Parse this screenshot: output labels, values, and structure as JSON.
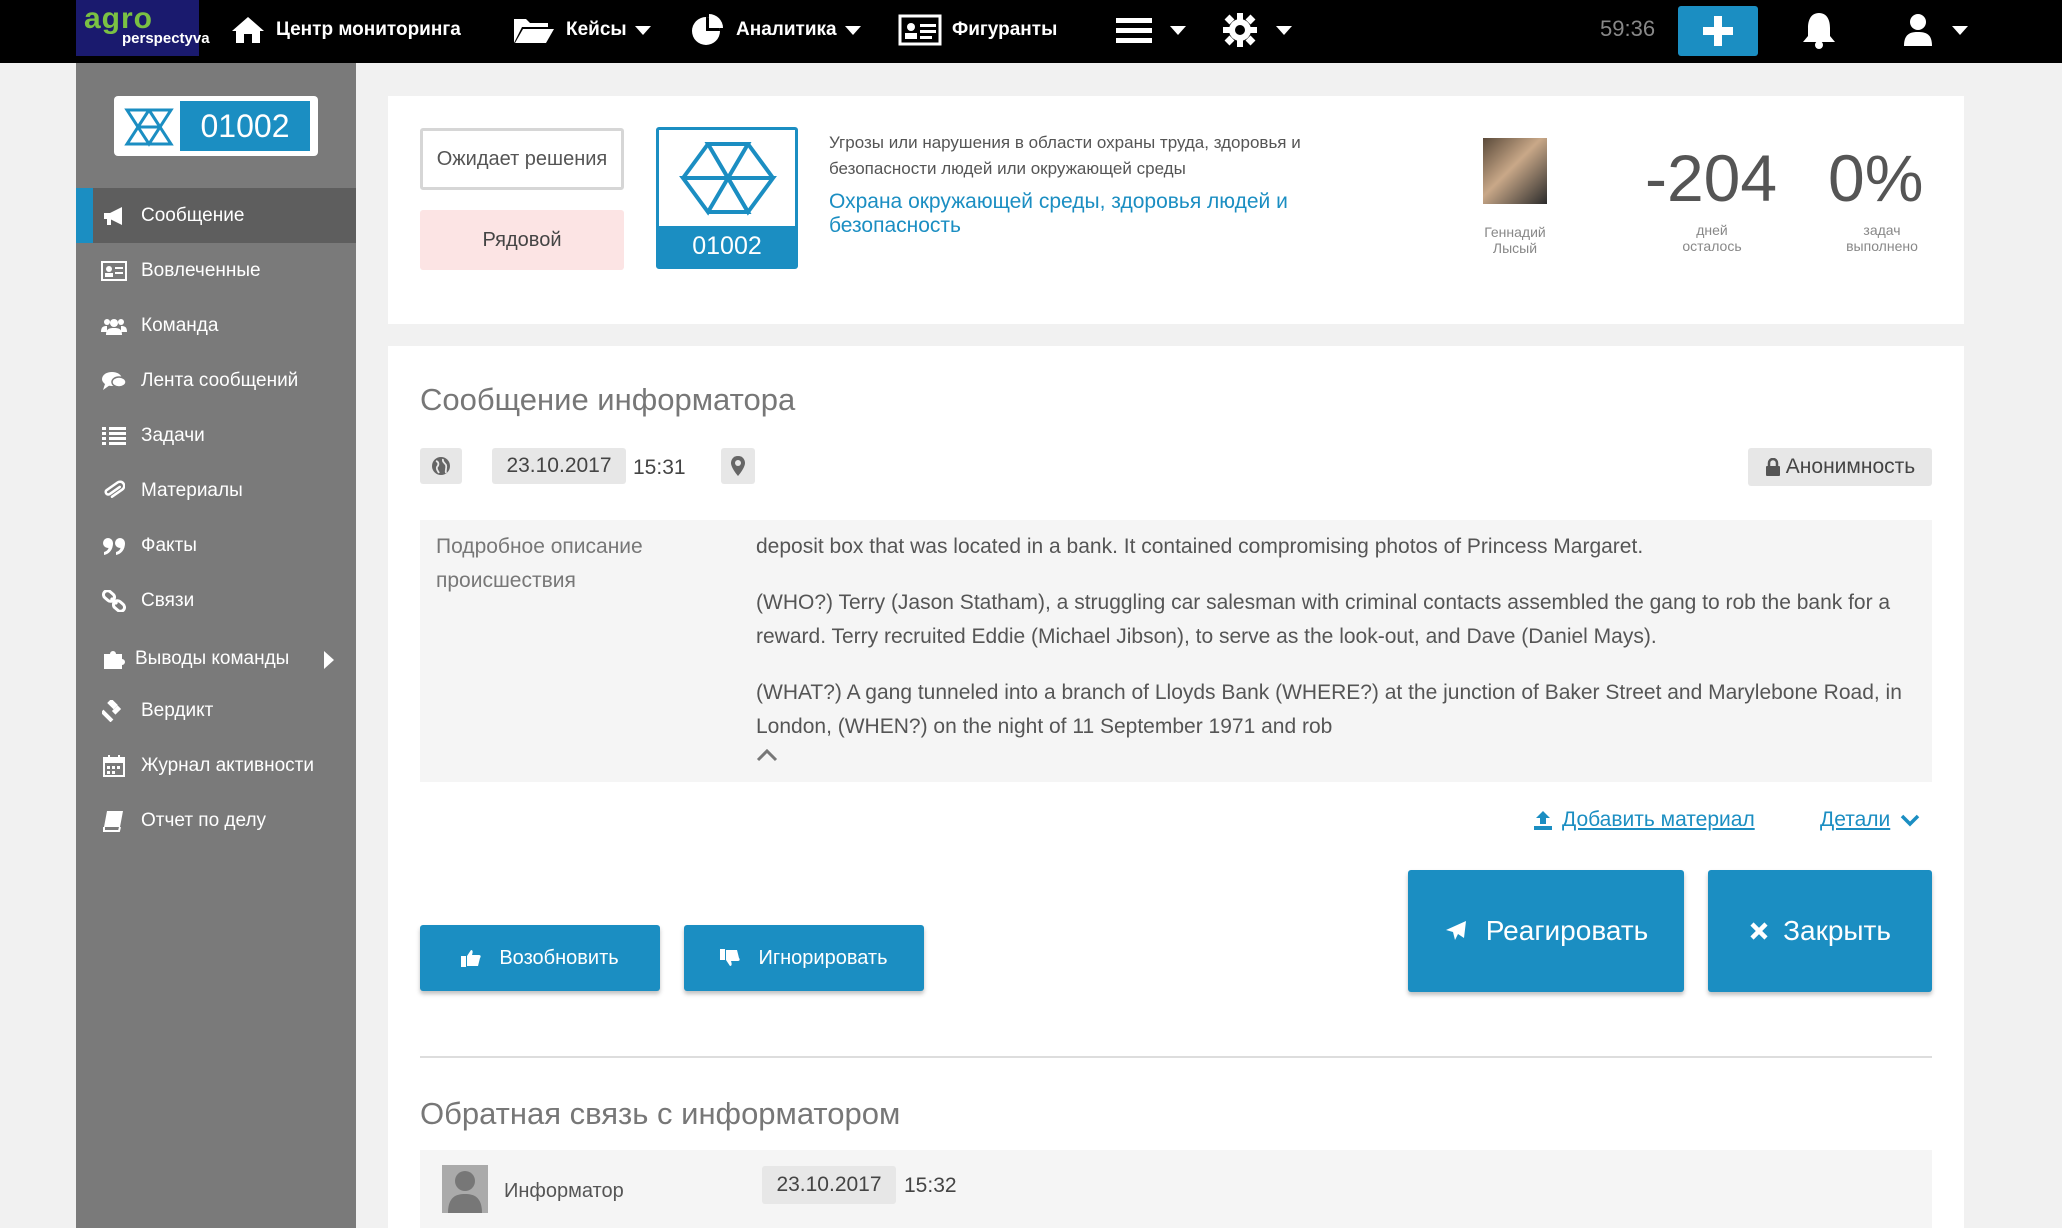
{
  "topbar": {
    "logo_top": "agro",
    "logo_bottom": "perspectyva",
    "nav": [
      {
        "label": "Центр мониторинга",
        "icon": "home-icon"
      },
      {
        "label": "Кейсы",
        "icon": "folder-icon"
      },
      {
        "label": "Аналитика",
        "icon": "pie-chart-icon"
      },
      {
        "label": "Фигуранты",
        "icon": "id-card-icon"
      }
    ],
    "timer": "59:36"
  },
  "sidebar": {
    "case_number": "01002",
    "items": [
      {
        "label": "Сообщение",
        "icon": "megaphone-icon",
        "active": true
      },
      {
        "label": "Вовлеченные",
        "icon": "id-card-icon"
      },
      {
        "label": "Команда",
        "icon": "users-icon"
      },
      {
        "label": "Лента сообщений",
        "icon": "comments-icon"
      },
      {
        "label": "Задачи",
        "icon": "list-icon"
      },
      {
        "label": "Материалы",
        "icon": "paperclip-icon"
      },
      {
        "label": "Факты",
        "icon": "quote-icon"
      },
      {
        "label": "Связи",
        "icon": "link-icon"
      },
      {
        "label": "Выводы команды",
        "icon": "puzzle-icon"
      },
      {
        "label": "Вердикт",
        "icon": "gavel-icon"
      },
      {
        "label": "Журнал активности",
        "icon": "calendar-icon"
      },
      {
        "label": "Отчет по делу",
        "icon": "book-icon"
      }
    ]
  },
  "header": {
    "status": "Ожидает решения",
    "rank": "Рядовой",
    "case_number": "01002",
    "category_desc": "Угрозы или нарушения в области охраны труда, здоровья и безопасности людей или окружающей среды",
    "category_link": "Охрана окружающей среды, здоровья людей и безопасность",
    "owner_line1": "Геннадий",
    "owner_line2": "Лысый",
    "days_value": "-204",
    "days_label1": "дней",
    "days_label2": "осталось",
    "tasks_value": "0%",
    "tasks_label1": "задач",
    "tasks_label2": "выполнено"
  },
  "message": {
    "title": "Сообщение информатора",
    "date": "23.10.2017",
    "time": "15:31",
    "anonymity": "Анонимность",
    "desc_label": "Подробное описание происшествия",
    "paragraphs": [
      "deposit box that was located in a bank. It contained compromising photos of Princess Margaret.",
      "(WHO?) Terry (Jason Statham), a struggling car salesman with criminal contacts assembled the gang to rob the bank for a reward. Terry recruited Eddie (Michael Jibson), to serve as the look-out, and Dave (Daniel Mays).",
      "(WHAT?) A gang tunneled into a branch of Lloyds Bank (WHERE?) at the junction of Baker Street and Marylebone Road, in London, (WHEN?) on the night of 11 September 1971 and rob"
    ],
    "add_material": "Добавить материал",
    "details": "Детали",
    "resume": "Возобновить",
    "ignore": "Игнорировать",
    "react": "Реагировать",
    "close": "Закрыть"
  },
  "feedback": {
    "title": "Обратная связь с информатором",
    "author": "Информатор",
    "date": "23.10.2017",
    "time": "15:32"
  }
}
